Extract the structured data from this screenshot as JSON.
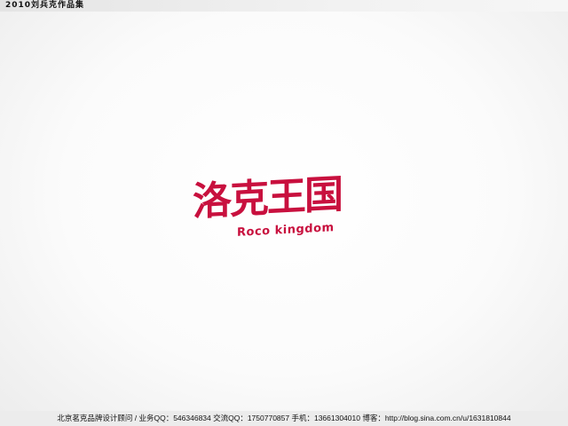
{
  "header": {
    "title": "2010刘兵克作品集"
  },
  "logo": {
    "chinese": "洛克王国",
    "english": "Roco kingdom",
    "color": "#c8103e"
  },
  "footer": {
    "text": "北京茗克品牌设计顾问 / 业务QQ：546346834  交流QQ：1750770857  手机：13661304010  博客：http://blog.sina.com.cn/u/1631810844"
  }
}
